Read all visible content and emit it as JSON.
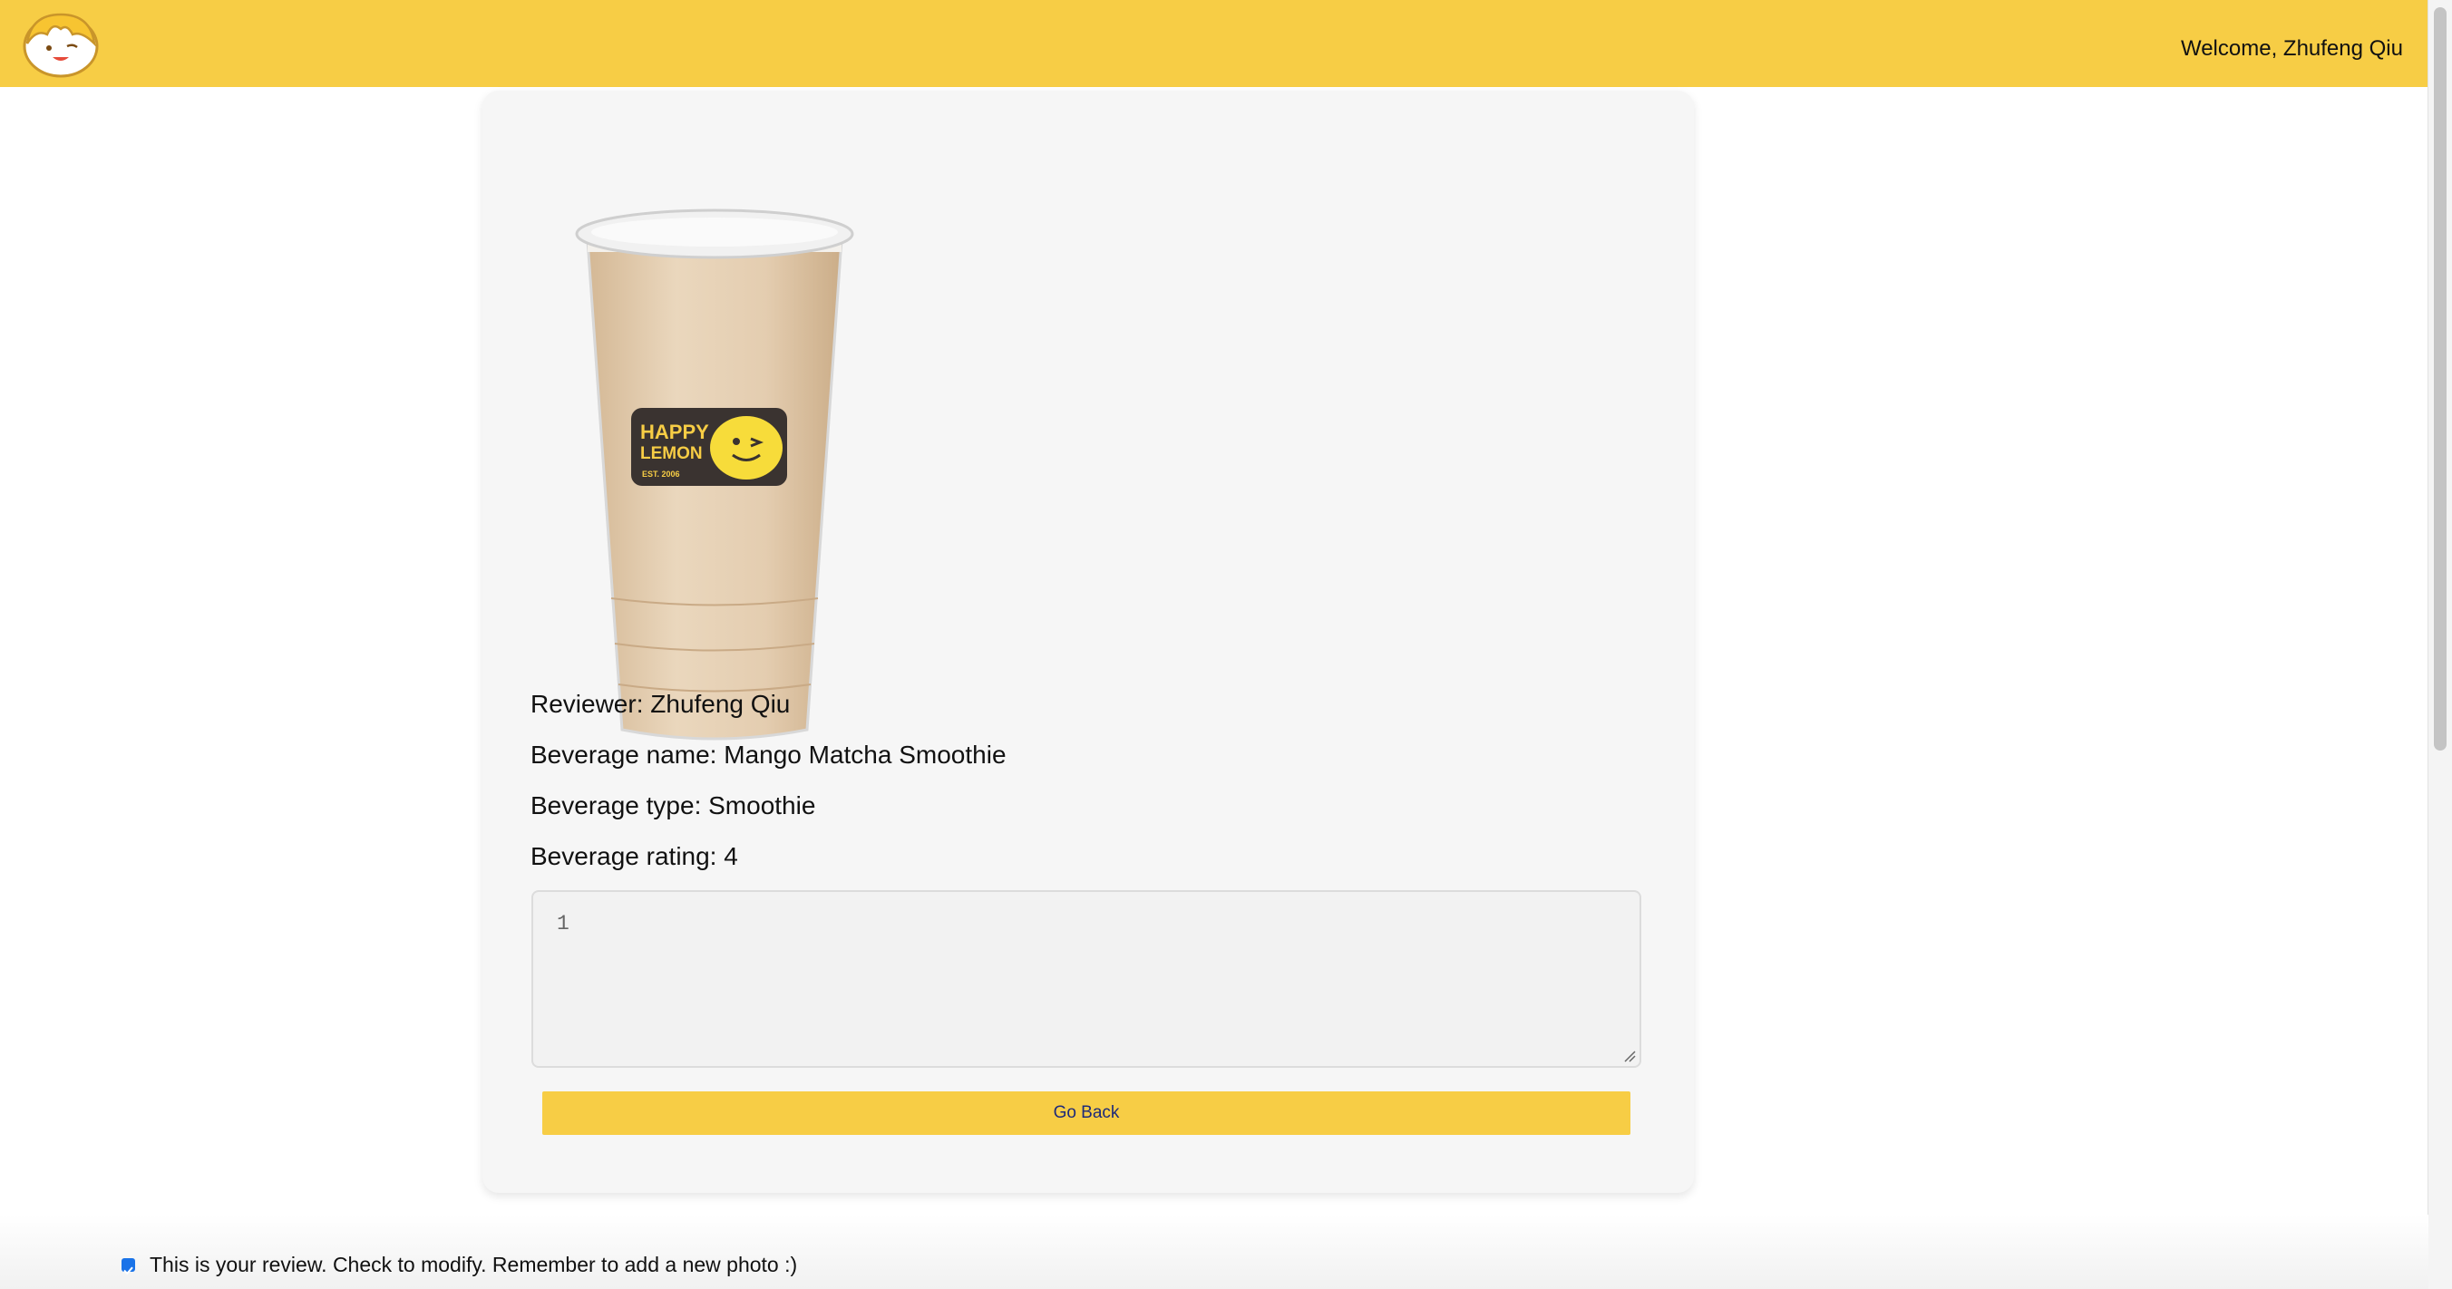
{
  "header": {
    "logo_icon": "happy-lemon-face-icon",
    "welcome_text": "Welcome, Zhufeng Qiu",
    "background_color": "#f7cd45"
  },
  "review": {
    "image_icon": "milk-tea-cup-image",
    "cup_label_line1": "HAPPY",
    "cup_label_line2": "LEMON",
    "cup_label_line3": "EST. 2006",
    "reviewer": "Reviewer: Zhufeng Qiu",
    "beverage_name": "Beverage name: Mango Matcha Smoothie",
    "beverage_type": "Beverage type: Smoothie",
    "beverage_rating": "Beverage rating: 4",
    "comment_value": "1",
    "go_back_label": "Go Back"
  },
  "footer": {
    "checkbox_checked": true,
    "checkbox_label": "This is your review. Check to modify. Remember to add a new photo :)"
  }
}
